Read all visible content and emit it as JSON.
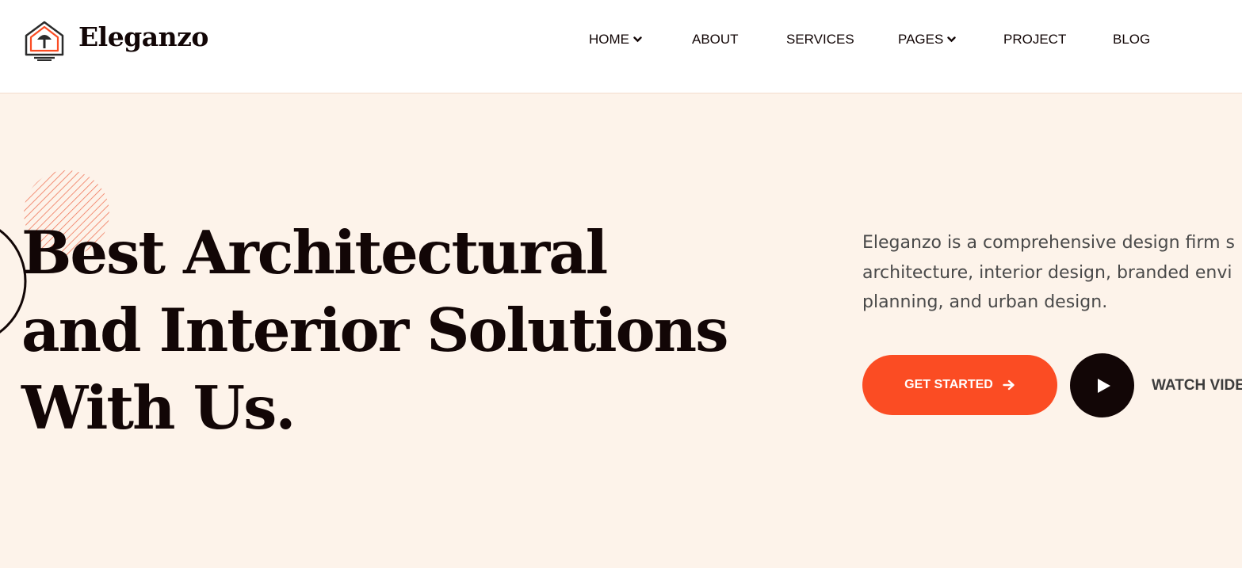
{
  "brand": {
    "name": "Eleganzo",
    "logo_icon": "house-lamp-icon",
    "accent_color": "#fb4c23"
  },
  "nav": {
    "items": [
      {
        "label": "HOME",
        "has_dropdown": true
      },
      {
        "label": "ABOUT",
        "has_dropdown": false
      },
      {
        "label": "SERVICES",
        "has_dropdown": false
      },
      {
        "label": "PAGES",
        "has_dropdown": true
      },
      {
        "label": "PROJECT",
        "has_dropdown": false
      },
      {
        "label": "BLOG",
        "has_dropdown": false
      }
    ]
  },
  "hero": {
    "headline_lines": [
      "Best Architectural",
      "and Interior Solutions",
      "With Us."
    ],
    "description_lines": [
      "Eleganzo is a comprehensive design firm s",
      "architecture, interior design, branded envi",
      "planning, and urban design."
    ],
    "cta_label": "GET STARTED",
    "cta_icon": "arrow-right-icon",
    "play_icon": "play-icon",
    "watch_label": "WATCH VIDEO",
    "background_color": "#fdf3ea",
    "text_color": "#120606"
  }
}
